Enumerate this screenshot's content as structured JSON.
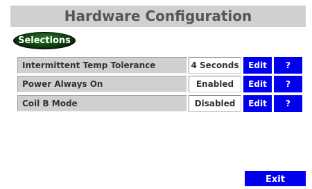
{
  "header": {
    "title": "Hardware Configuration"
  },
  "section": {
    "label": "Selections"
  },
  "settings": [
    {
      "label": "Intermittent Temp Tolerance",
      "value": "4 Seconds",
      "edit_label": "Edit",
      "help_label": "?"
    },
    {
      "label": "Power Always On",
      "value": "Enabled",
      "edit_label": "Edit",
      "help_label": "?"
    },
    {
      "label": "Coil B Mode",
      "value": "Disabled",
      "edit_label": "Edit",
      "help_label": "?"
    }
  ],
  "footer": {
    "exit_label": "Exit"
  },
  "colors": {
    "button_blue": "#0000ee",
    "title_bar_gray": "#d0d0d0",
    "pill_green": "#1f5f1f"
  }
}
